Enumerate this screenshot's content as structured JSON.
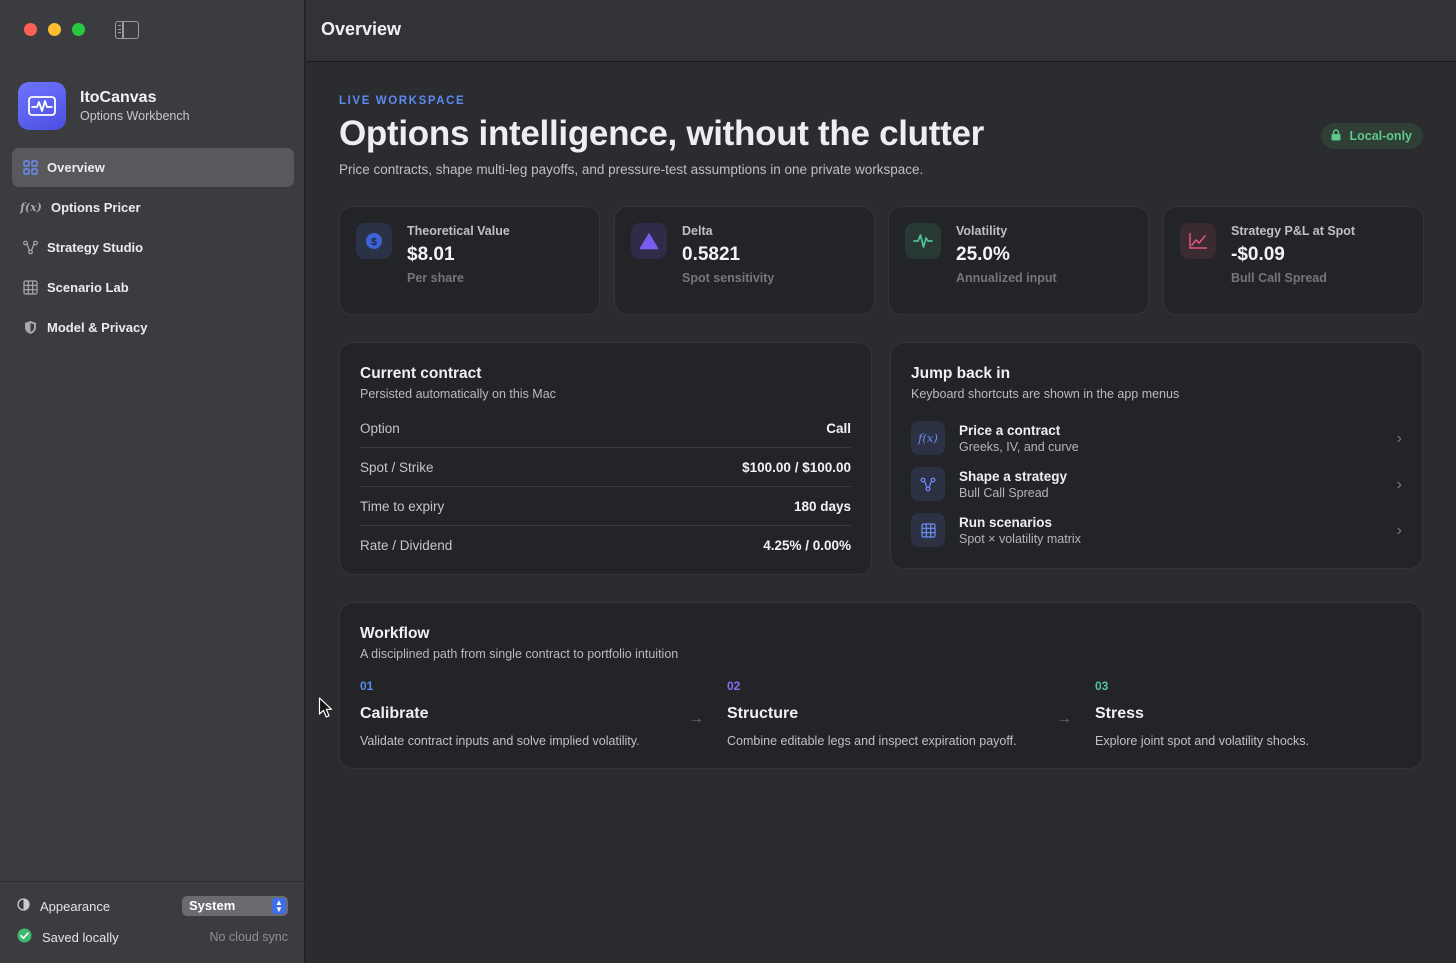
{
  "window": {
    "title": "Overview"
  },
  "sidebar": {
    "app_name": "ItoCanvas",
    "app_subtitle": "Options Workbench",
    "items": [
      {
        "label": "Overview",
        "icon": "grid-icon",
        "active": true
      },
      {
        "label": "Options Pricer",
        "icon": "function-icon",
        "glyph": "f(x)"
      },
      {
        "label": "Strategy Studio",
        "icon": "nodes-icon"
      },
      {
        "label": "Scenario Lab",
        "icon": "table-grid-icon"
      },
      {
        "label": "Model & Privacy",
        "icon": "shield-icon"
      }
    ],
    "footer": {
      "appearance_label": "Appearance",
      "appearance_value": "System",
      "saved_label": "Saved locally",
      "sync_label": "No cloud sync"
    }
  },
  "hero": {
    "eyebrow": "LIVE WORKSPACE",
    "title": "Options intelligence, without the clutter",
    "subtitle": "Price contracts, shape multi-leg payoffs, and pressure-test assumptions in one private workspace.",
    "badge": "Local-only"
  },
  "stats": [
    {
      "label": "Theoretical Value",
      "value": "$8.01",
      "note": "Per share",
      "icon": "dollar-icon",
      "color": "#3d63d8"
    },
    {
      "label": "Delta",
      "value": "0.5821",
      "note": "Spot sensitivity",
      "icon": "triangle-icon",
      "color": "#7a5cf0"
    },
    {
      "label": "Volatility",
      "value": "25.0%",
      "note": "Annualized input",
      "icon": "waveform-icon",
      "color": "#4fc49a"
    },
    {
      "label": "Strategy P&L at Spot",
      "value": "-$0.09",
      "note": "Bull Call Spread",
      "icon": "chart-line-icon",
      "color": "#e0567a"
    }
  ],
  "contract": {
    "title": "Current contract",
    "subtitle": "Persisted automatically on this Mac",
    "rows": [
      {
        "key": "Option",
        "value": "Call"
      },
      {
        "key": "Spot / Strike",
        "value": "$100.00 / $100.00"
      },
      {
        "key": "Time to expiry",
        "value": "180 days"
      },
      {
        "key": "Rate / Dividend",
        "value": "4.25% / 0.00%"
      }
    ]
  },
  "jump": {
    "title": "Jump back in",
    "subtitle": "Keyboard shortcuts are shown in the app menus",
    "items": [
      {
        "title": "Price a contract",
        "subtitle": "Greeks, IV, and curve",
        "icon": "function-icon",
        "glyph": "f(x)"
      },
      {
        "title": "Shape a strategy",
        "subtitle": "Bull Call Spread",
        "icon": "nodes-icon"
      },
      {
        "title": "Run scenarios",
        "subtitle": "Spot × volatility matrix",
        "icon": "table-grid-icon"
      }
    ]
  },
  "workflow": {
    "title": "Workflow",
    "subtitle": "A disciplined path from single contract to portfolio intuition",
    "steps": [
      {
        "num": "01",
        "title": "Calibrate",
        "desc": "Validate contract inputs and solve implied volatility.",
        "color": "#5b8af0"
      },
      {
        "num": "02",
        "title": "Structure",
        "desc": "Combine editable legs and inspect expiration payoff.",
        "color": "#8a6cf2"
      },
      {
        "num": "03",
        "title": "Stress",
        "desc": "Explore joint spot and volatility shocks.",
        "color": "#4fc49a"
      }
    ]
  },
  "colors": {
    "accent": "#5b8af0",
    "success": "#5fc98c",
    "negative": "#e0567a"
  }
}
